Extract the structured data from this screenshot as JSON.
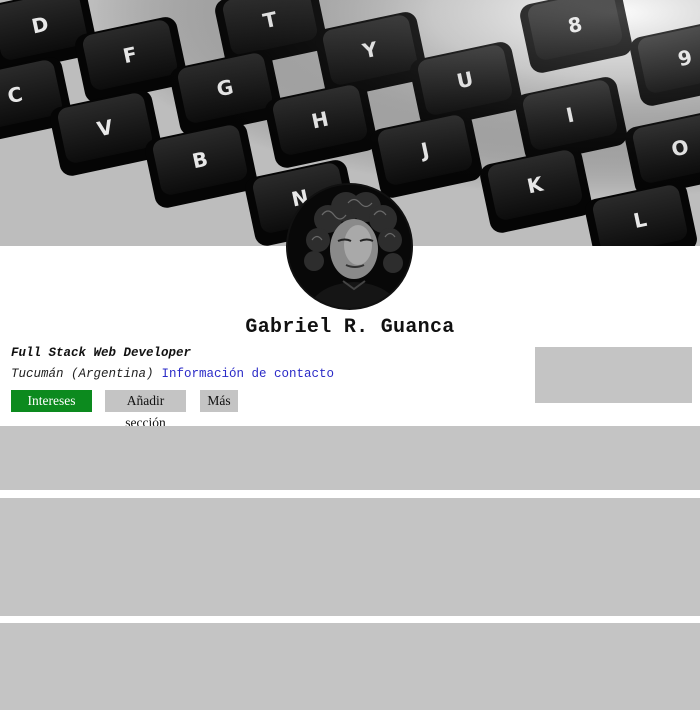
{
  "profile": {
    "name": "Gabriel R. Guanca",
    "headline": "Full Stack Web Developer",
    "location": "Tucumán (Argentina)",
    "contact_link": "Información de contacto"
  },
  "actions": {
    "primary_label": "Intereses",
    "add_section_label": "Añadir sección",
    "more_label": "Más"
  },
  "banner": {
    "image": "keyboard-closeup-photo",
    "key_letters": [
      "D",
      "T",
      "8",
      "9",
      "F",
      "Y",
      "G",
      "U",
      "C",
      "V",
      "H",
      "I",
      "O",
      "B",
      "J",
      "K",
      "N",
      "L"
    ]
  },
  "avatar": {
    "image": "profile-portrait-photo"
  },
  "colors": {
    "primary_button": "#0c8a1e",
    "placeholder_gray": "#c4c4c4",
    "link": "#2b2bc7"
  }
}
